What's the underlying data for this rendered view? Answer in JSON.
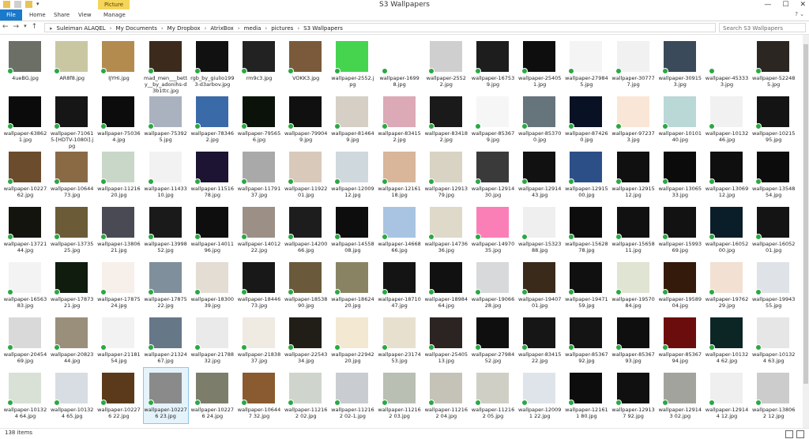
{
  "window": {
    "title": "S3 Wallpapers",
    "context_tab": "Picture Tools",
    "controls": [
      "—",
      "☐",
      "✕"
    ]
  },
  "ribbon": {
    "tabs": [
      "File",
      "Home",
      "Share",
      "View",
      "Manage"
    ],
    "help": "? ⌄"
  },
  "address": {
    "path": [
      "Suleiman ALAQEL",
      "My Documents",
      "My Dropbox",
      "AtrixBox",
      "media",
      "pictures",
      "S3 Wallpapers"
    ],
    "search_placeholder": "Search S3 Wallpapers"
  },
  "status": {
    "count": "138 items"
  },
  "thumb_palettes": [
    "#6b6f66",
    "#c9c7a2",
    "#b48b4f",
    "#3c2b1c",
    "#111111",
    "#222222",
    "#7a5a3a",
    "#46d44f",
    "#ffffff",
    "#cfcfcf",
    "#1d1d1d",
    "#0e0e0e",
    "#f4f4f4",
    "#f1f1f1",
    "#3a4a5a",
    "#ffffff",
    "#2c2622",
    "#0b0b0b",
    "#161616",
    "#0c0c0c",
    "#aab2bf",
    "#3b6aa8",
    "#0a120a",
    "#101010",
    "#d5cfc6",
    "#dca9b7",
    "#1a1a1a",
    "#f6f6f6",
    "#66747c",
    "#091224",
    "#fae6d7",
    "#b9d8d6",
    "#f1f1f1",
    "#141414",
    "#6b4c2c",
    "#8a6a45",
    "#c8d7c7",
    "#f2f2f2",
    "#1c1432",
    "#a9a9a9",
    "#d9c9bb",
    "#cfd8dd",
    "#d9b59a",
    "#d8d3c2",
    "#3a3a3a",
    "#111111",
    "#2d4f88",
    "#101010",
    "#0b0b0b",
    "#0f0f0f",
    "#0c0c0c",
    "#14140f",
    "#6b5b36",
    "#4a4a55",
    "#1a1a1a",
    "#0e0e0e",
    "#9b8f86",
    "#1d1d1d",
    "#0d0d0d",
    "#a8c4e2",
    "#ded9c9",
    "#fb7fb7",
    "#efefef",
    "#0d0d0d",
    "#111111",
    "#121212",
    "#0a1e2a",
    "#141414",
    "#f3f3f3",
    "#0f1c0e",
    "#f7efe9",
    "#7f8f9b",
    "#e4ddd4",
    "#181818",
    "#6a5a3b",
    "#8a8363",
    "#141414",
    "#111111",
    "#d7d9db",
    "#3a2a1a",
    "#101010",
    "#e0e4d2",
    "#331a0a",
    "#f2e0d2",
    "#dfe2e7",
    "#d9d9d9",
    "#9a8f7a",
    "#f2f2f2",
    "#667788",
    "#eaeaea",
    "#efeae2",
    "#201e17",
    "#f3e8d2",
    "#e8e0cf",
    "#2c2323",
    "#0f0f0f",
    "#161616",
    "#141414",
    "#0f0f0f",
    "#6c0d0d",
    "#0c2626",
    "#e6e6e6",
    "#d9e0d5",
    "#d7dde3",
    "#5a3a1a",
    "#8a8a8a",
    "#7d7d6b",
    "#8a5a30",
    "#cfd5cc",
    "#c9ccd0",
    "#b9bfb3",
    "#c5c3b8",
    "#cfcfc6",
    "#dfe4ea",
    "#0d0d0d",
    "#101010",
    "#a3a39d",
    "#efefef",
    "#cccccc"
  ],
  "rows": [
    [
      {
        "name": "4ueBG.jpg"
      },
      {
        "name": "AR8f8.jpg"
      },
      {
        "name": "IJYHi.jpg"
      },
      {
        "name": "mad_men___betty__by_adonihs-d3b1ttc.jpg"
      },
      {
        "name": "rgb_by_giulio1993-d3arbov.jpg"
      },
      {
        "name": "rm9c3.jpg"
      },
      {
        "name": "VOKK3.jpg"
      },
      {
        "name": "wallpaper-2552.jpg"
      },
      {
        "name": "wallpaper-16998.jpg"
      },
      {
        "name": "wallpaper-25522.jpg"
      },
      {
        "name": "wallpaper-167539.jpg"
      },
      {
        "name": "wallpaper-254051.jpg"
      },
      {
        "name": "wallpaper-279845.jpg"
      },
      {
        "name": "wallpaper-307777.jpg"
      },
      {
        "name": "wallpaper-309153.jpg"
      },
      {
        "name": "wallpaper-453333.jpg"
      },
      {
        "name": "wallpaper-522485.jpg"
      }
    ],
    [
      {
        "name": "wallpaper-638621.jpg"
      },
      {
        "name": "wallpaper-710615-[HDTV-1080i].jpg"
      },
      {
        "name": "wallpaper-750364.jpg"
      },
      {
        "name": "wallpaper-753925.jpg"
      },
      {
        "name": "wallpaper-783462.jpg"
      },
      {
        "name": "wallpaper-795656.jpg"
      },
      {
        "name": "wallpaper-799049.jpg"
      },
      {
        "name": "wallpaper-814649.jpg"
      },
      {
        "name": "wallpaper-834152.jpg"
      },
      {
        "name": "wallpaper-834182.jpg"
      },
      {
        "name": "wallpaper-853679.jpg"
      },
      {
        "name": "wallpaper-853700.jpg"
      },
      {
        "name": "wallpaper-874260.jpg"
      },
      {
        "name": "wallpaper-972373.jpg"
      },
      {
        "name": "wallpaper-1010140.jpg"
      },
      {
        "name": "wallpaper-1013246.jpg"
      },
      {
        "name": "wallpaper-1021595.jpg"
      }
    ],
    [
      {
        "name": "wallpaper-1022762.jpg"
      },
      {
        "name": "wallpaper-1064473.jpg"
      },
      {
        "name": "wallpaper-1121620.jpg"
      },
      {
        "name": "wallpaper-1143310.jpg"
      },
      {
        "name": "wallpaper-1151678.jpg"
      },
      {
        "name": "wallpaper-1179137.jpg"
      },
      {
        "name": "wallpaper-1192201.jpg"
      },
      {
        "name": "wallpaper-1200912.jpg"
      },
      {
        "name": "wallpaper-1216118.jpg"
      },
      {
        "name": "wallpaper-1291379.jpg"
      },
      {
        "name": "wallpaper-1291430.jpg"
      },
      {
        "name": "wallpaper-1291443.jpg"
      },
      {
        "name": "wallpaper-1291500.jpg"
      },
      {
        "name": "wallpaper-1291512.jpg"
      },
      {
        "name": "wallpaper-1306533.jpg"
      },
      {
        "name": "wallpaper-1306912.jpg"
      },
      {
        "name": "wallpaper-1354854.jpg"
      }
    ],
    [
      {
        "name": "wallpaper-1372144.jpg"
      },
      {
        "name": "wallpaper-1373525.jpg"
      },
      {
        "name": "wallpaper-1380621.jpg"
      },
      {
        "name": "wallpaper-1399852.jpg"
      },
      {
        "name": "wallpaper-1401196.jpg"
      },
      {
        "name": "wallpaper-1401222.jpg"
      },
      {
        "name": "wallpaper-1420066.jpg"
      },
      {
        "name": "wallpaper-1455808.jpg"
      },
      {
        "name": "wallpaper-1466866.jpg"
      },
      {
        "name": "wallpaper-1473636.jpg"
      },
      {
        "name": "wallpaper-1497035.jpg"
      },
      {
        "name": "wallpaper-1532388.jpg"
      },
      {
        "name": "wallpaper-1562878.jpg"
      },
      {
        "name": "wallpaper-1565811.jpg"
      },
      {
        "name": "wallpaper-1599369.jpg"
      },
      {
        "name": "wallpaper-1605200.jpg"
      },
      {
        "name": "wallpaper-1605201.jpg"
      }
    ],
    [
      {
        "name": "wallpaper-1656383.jpg"
      },
      {
        "name": "wallpaper-1787321.jpg"
      },
      {
        "name": "wallpaper-1787524.jpg"
      },
      {
        "name": "wallpaper-1787522.jpg"
      },
      {
        "name": "wallpaper-1830039.jpg"
      },
      {
        "name": "wallpaper-1844673.jpg"
      },
      {
        "name": "wallpaper-1853890.jpg"
      },
      {
        "name": "wallpaper-1862420.jpg"
      },
      {
        "name": "wallpaper-1871047.jpg"
      },
      {
        "name": "wallpaper-1898464.jpg"
      },
      {
        "name": "wallpaper-1906628.jpg"
      },
      {
        "name": "wallpaper-1940701.jpg"
      },
      {
        "name": "wallpaper-1947159.jpg"
      },
      {
        "name": "wallpaper-1957084.jpg"
      },
      {
        "name": "wallpaper-1958904.jpg"
      },
      {
        "name": "wallpaper-1976229.jpg"
      },
      {
        "name": "wallpaper-1994355.jpg"
      }
    ],
    [
      {
        "name": "wallpaper-2045469.jpg"
      },
      {
        "name": "wallpaper-2082344.jpg"
      },
      {
        "name": "wallpaper-2118154.jpg"
      },
      {
        "name": "wallpaper-2132467.jpg"
      },
      {
        "name": "wallpaper-2178832.jpg"
      },
      {
        "name": "wallpaper-2183837.jpg"
      },
      {
        "name": "wallpaper-2254334.jpg"
      },
      {
        "name": "wallpaper-2294220.jpg"
      },
      {
        "name": "wallpaper-2317453.jpg"
      },
      {
        "name": "wallpaper-2540513.jpg"
      },
      {
        "name": "wallpaper-2798452.jpg"
      },
      {
        "name": "wallpaper-8341522.jpg"
      },
      {
        "name": "wallpaper-8536792.jpg"
      },
      {
        "name": "wallpaper-8536793.jpg"
      },
      {
        "name": "wallpaper-8536794.jpg"
      },
      {
        "name": "wallpaper-101324 62.jpg"
      },
      {
        "name": "wallpaper-101324 63.jpg"
      }
    ],
    [
      {
        "name": "wallpaper-101324 64.jpg"
      },
      {
        "name": "wallpaper-101324 65.jpg"
      },
      {
        "name": "wallpaper-102276 22.jpg"
      },
      {
        "name": "wallpaper-102276 23.jpg"
      },
      {
        "name": "wallpaper-102276 24.jpg"
      },
      {
        "name": "wallpaper-106447 32.jpg"
      },
      {
        "name": "wallpaper-112162 02.jpg"
      },
      {
        "name": "wallpaper-112162 02-1.jpg"
      },
      {
        "name": "wallpaper-112162 03.jpg"
      },
      {
        "name": "wallpaper-112162 04.jpg"
      },
      {
        "name": "wallpaper-112162 05.jpg"
      },
      {
        "name": "wallpaper-120091 22.jpg"
      },
      {
        "name": "wallpaper-121611 80.jpg"
      },
      {
        "name": "wallpaper-129137 92.jpg"
      },
      {
        "name": "wallpaper-129143 02.jpg"
      },
      {
        "name": "wallpaper-129144 12.jpg"
      },
      {
        "name": "wallpaper-138062 12.jpg"
      }
    ]
  ]
}
